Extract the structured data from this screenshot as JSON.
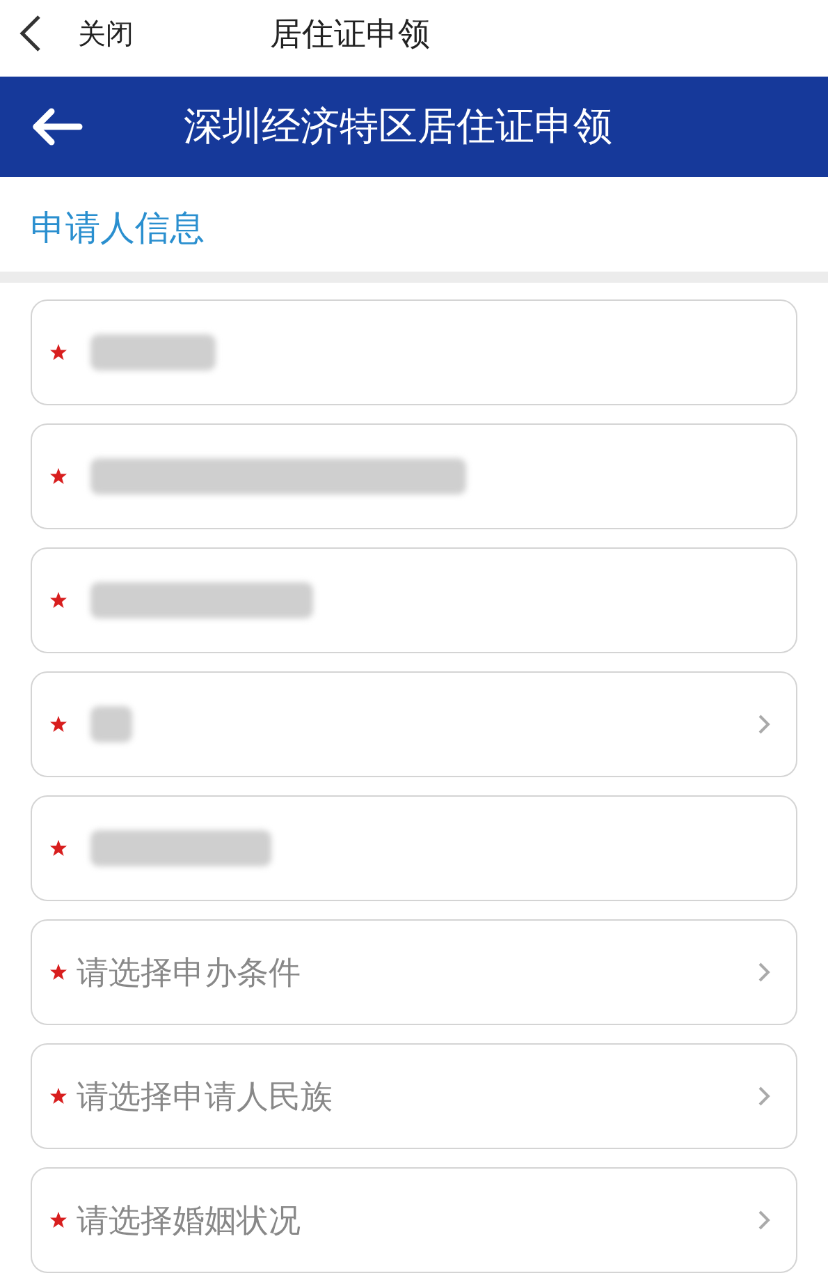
{
  "top_bar": {
    "close": "关闭",
    "title": "居住证申领"
  },
  "header": {
    "title": "深圳经济特区居住证申领"
  },
  "section": {
    "title": "申请人信息"
  },
  "fields": [
    {
      "kind": "redacted",
      "required": true,
      "has_arrow": false
    },
    {
      "kind": "redacted",
      "required": true,
      "has_arrow": false
    },
    {
      "kind": "redacted",
      "required": true,
      "has_arrow": false
    },
    {
      "kind": "redacted",
      "required": true,
      "has_arrow": true
    },
    {
      "kind": "redacted",
      "required": true,
      "has_arrow": false
    },
    {
      "kind": "select",
      "required": true,
      "has_arrow": true,
      "placeholder": "请选择申办条件"
    },
    {
      "kind": "select",
      "required": true,
      "has_arrow": true,
      "placeholder": "请选择申请人民族"
    },
    {
      "kind": "select",
      "required": true,
      "has_arrow": true,
      "placeholder": "请选择婚姻状况"
    }
  ]
}
